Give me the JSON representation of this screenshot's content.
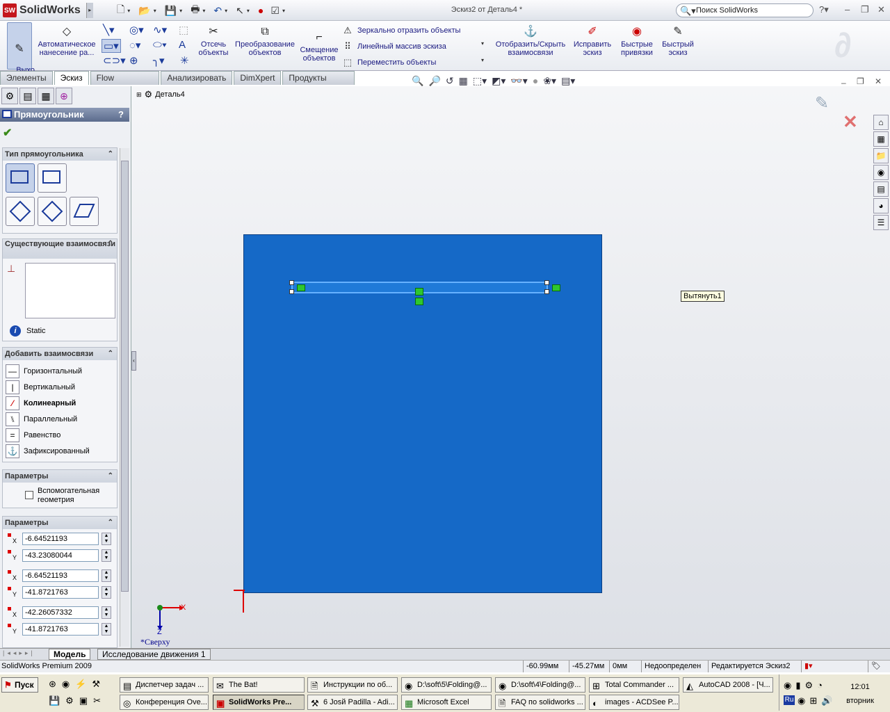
{
  "app": {
    "brand": "SolidWorks",
    "window_title": "Эскиз2 от Деталь4 *",
    "search_placeholder": "Поиск SolidWorks"
  },
  "command_manager": {
    "exit_sketch": "Выхо\nд и...",
    "smart_dim": "Автоматическое нанесение ра...",
    "trim": "Отсечь объекты",
    "convert": "Преобразование объектов",
    "offset": "Смещение объектов",
    "mirror": "Зеркально отразить объекты",
    "linear_pattern": "Линейный массив эскиза",
    "move": "Переместить объекты",
    "show_hide_rel": "Отобразить/Скрыть взаимосвязи",
    "repair": "Исправить эскиз",
    "quick_snaps": "Быстрые привязки",
    "rapid_sketch": "Быстрый эскиз"
  },
  "tabs": [
    "Элементы",
    "Эскиз",
    "Flow Simulation",
    "Анализировать",
    "DimXpert",
    "Продукты Office"
  ],
  "active_tab": "Эскиз",
  "property_manager": {
    "title": "Прямоугольник",
    "help": "?",
    "group_type": "Тип прямоугольника",
    "group_existing": "Существующие взаимосвязи",
    "static_label": "Static",
    "group_add": "Добавить взаимосвязи",
    "relations": [
      "Горизонтальный",
      "Вертикальный",
      "Колинеарный",
      "Параллельный",
      "Равенство",
      "Зафиксированный"
    ],
    "group_options": "Параметры",
    "construction": "Вспомогательная геометрия",
    "group_params": "Параметры",
    "params": [
      {
        "axis": "X",
        "value": "-6.64521193"
      },
      {
        "axis": "Y",
        "value": "-43.23080044"
      },
      {
        "axis": "X",
        "value": "-6.64521193"
      },
      {
        "axis": "Y",
        "value": "-41.8721763"
      },
      {
        "axis": "X",
        "value": "-42.26057332"
      },
      {
        "axis": "Y",
        "value": "-41.8721763"
      }
    ]
  },
  "graphics": {
    "tree_root": "Деталь4",
    "tooltip": "Вытянуть1",
    "view_name": "*Сверху",
    "triad_x": "X",
    "triad_z": "Z"
  },
  "bottom_tabs": [
    "Модель",
    "Исследование движения 1"
  ],
  "status": {
    "product": "SolidWorks Premium 2009",
    "x": "-60.99мм",
    "y": "-45.27мм",
    "z": "0мм",
    "state": "Недоопределен",
    "editing": "Редактируется Эскиз2"
  },
  "taskbar": {
    "start": "Пуск",
    "row1": [
      "Диспетчер задач ...",
      "The Bat!",
      "Инструкции по об...",
      "D:\\soft\\5\\Folding@...",
      "D:\\soft\\4\\Folding@...",
      "Total Commander ...",
      "AutoCAD 2008 - [Ч..."
    ],
    "row2": [
      "Конференция Ove...",
      "SolidWorks Pre...",
      "6 Josй Padilla - Adi...",
      "Microsoft Excel",
      "FAQ по solidworks ...",
      "images - ACDSee P..."
    ],
    "time": "12:01",
    "day": "вторник",
    "lang": "Ru"
  }
}
